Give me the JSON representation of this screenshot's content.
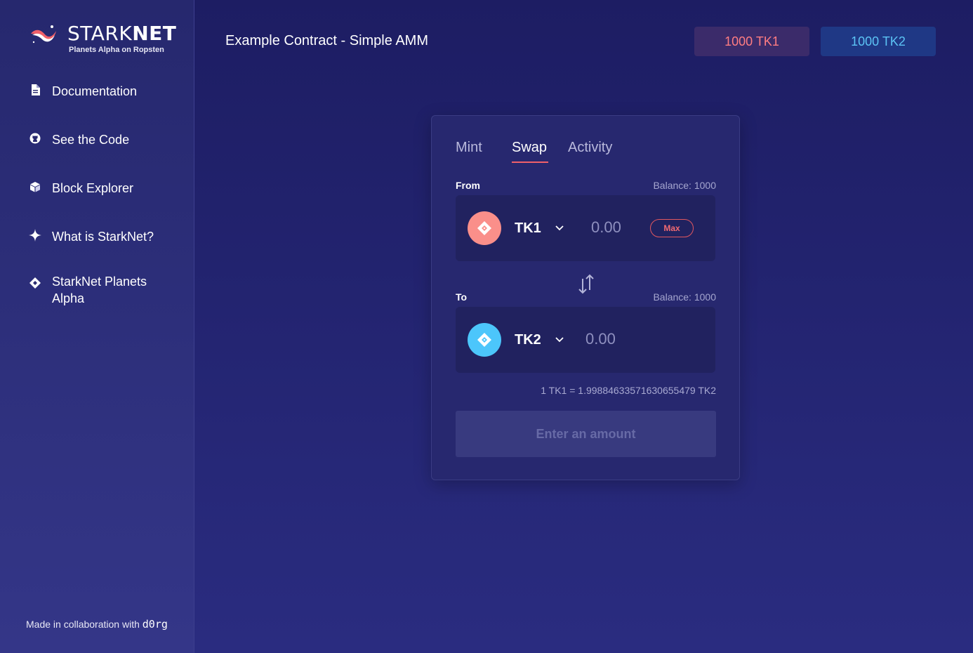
{
  "sidebar": {
    "logo": {
      "wordmark_light": "STARK",
      "wordmark_bold": "NET",
      "subtitle": "Planets Alpha on Ropsten"
    },
    "items": [
      {
        "label": "Documentation",
        "icon": "document-icon"
      },
      {
        "label": "See the Code",
        "icon": "github-icon"
      },
      {
        "label": "Block Explorer",
        "icon": "cube-icon"
      },
      {
        "label": "What is StarkNet?",
        "icon": "sparkle-icon"
      },
      {
        "label": "StarkNet Planets Alpha",
        "icon": "diamond-icon"
      }
    ],
    "footer": {
      "text": "Made in collaboration with ",
      "brand": "d0rg"
    }
  },
  "header": {
    "title": "Example Contract - Simple AMM",
    "balances": [
      {
        "label": "1000 TK1",
        "color": "#ff7d82"
      },
      {
        "label": "1000 TK2",
        "color": "#5cc4f5"
      }
    ]
  },
  "swap_card": {
    "tabs": [
      {
        "label": "Mint",
        "active": false
      },
      {
        "label": "Swap",
        "active": true
      },
      {
        "label": "Activity",
        "active": false
      }
    ],
    "from": {
      "label": "From",
      "balance": "Balance: 1000",
      "token": "TK1",
      "token_color": "#fa8f8a",
      "amount_placeholder": "0.00",
      "max_label": "Max"
    },
    "to": {
      "label": "To",
      "balance": "Balance: 1000",
      "token": "TK2",
      "token_color": "#4cc6fb",
      "amount_placeholder": "0.00"
    },
    "rate": "1 TK1 = 1.99884633571630655479 TK2",
    "submit_label": "Enter an amount"
  },
  "colors": {
    "accent": "#f0606a",
    "background": "#1d1d63",
    "card": "#27286f"
  }
}
